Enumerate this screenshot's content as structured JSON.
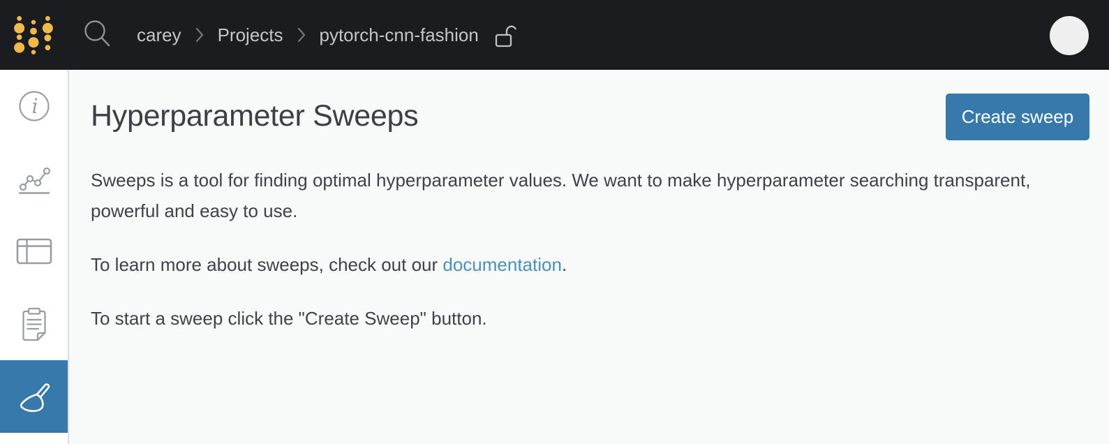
{
  "colors": {
    "topbar_bg": "#1b1c1f",
    "logo_gold": "#f0b94a",
    "accent_blue": "#3779ab",
    "link_blue": "#4a90ba",
    "sidebar_bg": "#ffffff",
    "main_bg": "#f8f9f9"
  },
  "topbar": {
    "logo_icon": "wandb-dots-logo",
    "search_icon": "search-icon",
    "breadcrumb": {
      "items": [
        "carey",
        "Projects",
        "pytorch-cnn-fashion"
      ],
      "separator_icon": "chevron-right-icon",
      "visibility_icon": "unlocked-padlock-icon"
    },
    "avatar_icon": "user-avatar"
  },
  "sidebar": {
    "items": [
      {
        "icon": "info-icon",
        "selected": false
      },
      {
        "icon": "line-chart-icon",
        "selected": false
      },
      {
        "icon": "table-icon",
        "selected": false
      },
      {
        "icon": "clipboard-icon",
        "selected": false
      },
      {
        "icon": "broom-icon",
        "selected": true
      }
    ]
  },
  "main": {
    "title": "Hyperparameter Sweeps",
    "create_button": {
      "label": "Create sweep"
    },
    "paragraph_1": "Sweeps is a tool for finding optimal hyperparameter values. We want to make hyperparameter searching transparent, powerful and easy to use.",
    "paragraph_2": {
      "prefix": "To learn more about sweeps, check out our ",
      "link_text": "documentation",
      "suffix": "."
    },
    "paragraph_3": "To start a sweep click the \"Create Sweep\" button."
  }
}
